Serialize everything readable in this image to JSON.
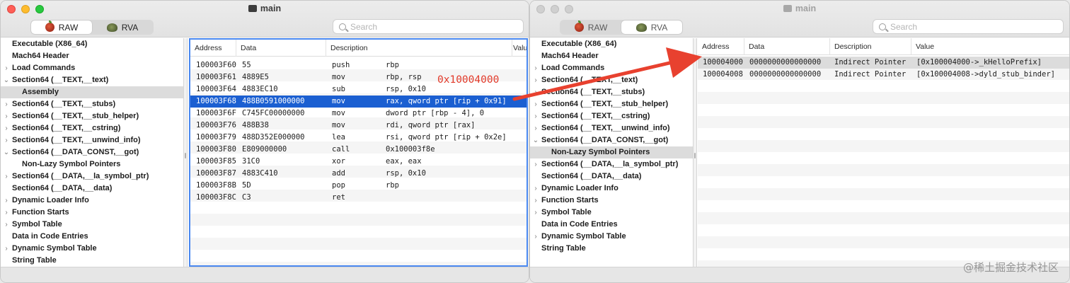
{
  "left_window": {
    "title": "main",
    "segments": [
      {
        "label": "RAW",
        "icon": "apple-icon",
        "active": true
      },
      {
        "label": "RVA",
        "icon": "turtle-icon",
        "active": false
      }
    ],
    "search_placeholder": "Search",
    "tree": [
      {
        "label": "Executable  (X86_64)",
        "level": 0,
        "disclosure": "open"
      },
      {
        "label": "Mach64 Header",
        "level": 1,
        "disclosure": "none"
      },
      {
        "label": "Load Commands",
        "level": 1,
        "disclosure": "closed"
      },
      {
        "label": "Section64 (__TEXT,__text)",
        "level": 1,
        "disclosure": "open"
      },
      {
        "label": "Assembly",
        "level": 2,
        "disclosure": "none",
        "selected": true
      },
      {
        "label": "Section64 (__TEXT,__stubs)",
        "level": 1,
        "disclosure": "closed"
      },
      {
        "label": "Section64 (__TEXT,__stub_helper)",
        "level": 1,
        "disclosure": "closed"
      },
      {
        "label": "Section64 (__TEXT,__cstring)",
        "level": 1,
        "disclosure": "closed"
      },
      {
        "label": "Section64 (__TEXT,__unwind_info)",
        "level": 1,
        "disclosure": "closed"
      },
      {
        "label": "Section64 (__DATA_CONST,__got)",
        "level": 1,
        "disclosure": "open"
      },
      {
        "label": "Non-Lazy Symbol Pointers",
        "level": 2,
        "disclosure": "none"
      },
      {
        "label": "Section64 (__DATA,__la_symbol_ptr)",
        "level": 1,
        "disclosure": "closed"
      },
      {
        "label": "Section64 (__DATA,__data)",
        "level": 1,
        "disclosure": "none"
      },
      {
        "label": "Dynamic Loader Info",
        "level": 1,
        "disclosure": "closed"
      },
      {
        "label": "Function Starts",
        "level": 1,
        "disclosure": "closed"
      },
      {
        "label": "Symbol Table",
        "level": 1,
        "disclosure": "closed"
      },
      {
        "label": "Data in Code Entries",
        "level": 1,
        "disclosure": "none"
      },
      {
        "label": "Dynamic Symbol Table",
        "level": 1,
        "disclosure": "closed"
      },
      {
        "label": "String Table",
        "level": 1,
        "disclosure": "none"
      }
    ],
    "columns": [
      "Address",
      "Data",
      "Description",
      "Value"
    ],
    "rows": [
      {
        "address": "100003F60",
        "data": "55",
        "mnemonic": "push",
        "operands": "rbp"
      },
      {
        "address": "100003F61",
        "data": "4889E5",
        "mnemonic": "mov",
        "operands": "rbp, rsp"
      },
      {
        "address": "100003F64",
        "data": "4883EC10",
        "mnemonic": "sub",
        "operands": "rsp, 0x10"
      },
      {
        "address": "100003F68",
        "data": "488B0591000000",
        "mnemonic": "mov",
        "operands": "rax, qword ptr [rip + 0x91]",
        "selected": true
      },
      {
        "address": "100003F6F",
        "data": "C745FC00000000",
        "mnemonic": "mov",
        "operands": "dword ptr [rbp - 4], 0"
      },
      {
        "address": "100003F76",
        "data": "488B38",
        "mnemonic": "mov",
        "operands": "rdi, qword ptr [rax]"
      },
      {
        "address": "100003F79",
        "data": "488D352E000000",
        "mnemonic": "lea",
        "operands": "rsi, qword ptr [rip + 0x2e]"
      },
      {
        "address": "100003F80",
        "data": "E809000000",
        "mnemonic": "call",
        "operands": "0x100003f8e"
      },
      {
        "address": "100003F85",
        "data": "31C0",
        "mnemonic": "xor",
        "operands": "eax, eax"
      },
      {
        "address": "100003F87",
        "data": "4883C410",
        "mnemonic": "add",
        "operands": "rsp, 0x10"
      },
      {
        "address": "100003F8B",
        "data": "5D",
        "mnemonic": "pop",
        "operands": "rbp"
      },
      {
        "address": "100003F8C",
        "data": "C3",
        "mnemonic": "ret",
        "operands": ""
      }
    ],
    "annotation": "0x10004000"
  },
  "right_window": {
    "title": "main",
    "segments": [
      {
        "label": "RAW",
        "icon": "apple-icon",
        "active": false
      },
      {
        "label": "RVA",
        "icon": "turtle-icon",
        "active": true
      }
    ],
    "search_placeholder": "Search",
    "tree": [
      {
        "label": "Executable  (X86_64)",
        "level": 0,
        "disclosure": "open"
      },
      {
        "label": "Mach64 Header",
        "level": 1,
        "disclosure": "none"
      },
      {
        "label": "Load Commands",
        "level": 1,
        "disclosure": "closed"
      },
      {
        "label": "Section64 (__TEXT,__text)",
        "level": 1,
        "disclosure": "closed"
      },
      {
        "label": "Section64 (__TEXT,__stubs)",
        "level": 1,
        "disclosure": "closed"
      },
      {
        "label": "Section64 (__TEXT,__stub_helper)",
        "level": 1,
        "disclosure": "closed"
      },
      {
        "label": "Section64 (__TEXT,__cstring)",
        "level": 1,
        "disclosure": "closed"
      },
      {
        "label": "Section64 (__TEXT,__unwind_info)",
        "level": 1,
        "disclosure": "closed"
      },
      {
        "label": "Section64 (__DATA_CONST,__got)",
        "level": 1,
        "disclosure": "open"
      },
      {
        "label": "Non-Lazy Symbol Pointers",
        "level": 2,
        "disclosure": "none",
        "selected": true
      },
      {
        "label": "Section64 (__DATA,__la_symbol_ptr)",
        "level": 1,
        "disclosure": "closed"
      },
      {
        "label": "Section64 (__DATA,__data)",
        "level": 1,
        "disclosure": "none"
      },
      {
        "label": "Dynamic Loader Info",
        "level": 1,
        "disclosure": "closed"
      },
      {
        "label": "Function Starts",
        "level": 1,
        "disclosure": "closed"
      },
      {
        "label": "Symbol Table",
        "level": 1,
        "disclosure": "closed"
      },
      {
        "label": "Data in Code Entries",
        "level": 1,
        "disclosure": "none"
      },
      {
        "label": "Dynamic Symbol Table",
        "level": 1,
        "disclosure": "closed"
      },
      {
        "label": "String Table",
        "level": 1,
        "disclosure": "none"
      }
    ],
    "columns": [
      "Address",
      "Data",
      "Description",
      "Value"
    ],
    "rows": [
      {
        "address": "100004000",
        "data": "0000000000000000",
        "description": "Indirect Pointer",
        "value": "[0x100004000->_kHelloPrefix]",
        "selected": true
      },
      {
        "address": "100004008",
        "data": "0000000000000000",
        "description": "Indirect Pointer",
        "value": "[0x100004008->dyld_stub_binder]"
      }
    ]
  },
  "watermark": "@稀土掘金技术社区",
  "colors": {
    "selection": "#1b5fd1",
    "annotation": "#e23a2a",
    "focus_border": "#4a88f0"
  }
}
